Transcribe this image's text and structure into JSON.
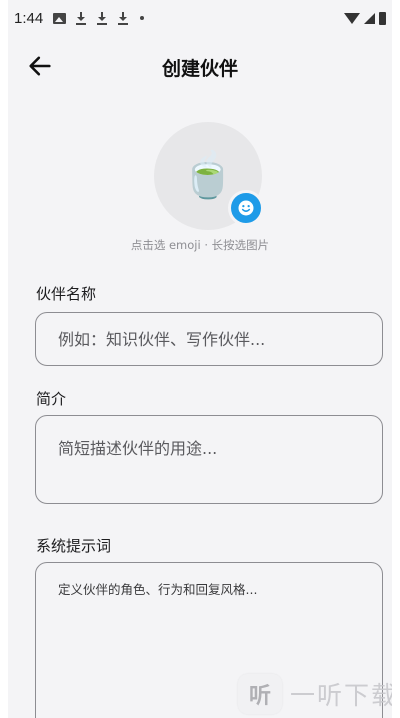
{
  "status_bar": {
    "time": "1:44",
    "left_icons": [
      "image-icon",
      "download-icon",
      "download-icon",
      "download-icon",
      "dot-icon"
    ],
    "right_icons": [
      "wifi-icon",
      "signal-icon",
      "battery-icon"
    ]
  },
  "app_bar": {
    "back_icon": "arrow-left-icon",
    "title": "创建伙伴"
  },
  "avatar": {
    "emoji": "🍵",
    "badge_icon": "emoji-smile-icon",
    "hint": "点击选 emoji · 长按选图片",
    "accent_color": "#1e9be8"
  },
  "form": {
    "name": {
      "label": "伙伴名称",
      "value": "",
      "placeholder": "例如：知识伙伴、写作伙伴..."
    },
    "description": {
      "label": "简介",
      "value": "",
      "placeholder": "简短描述伙伴的用途..."
    },
    "system_prompt": {
      "label": "系统提示词",
      "value": "",
      "placeholder": "定义伙伴的角色、行为和回复风格..."
    }
  },
  "watermark": {
    "logo_char": "听",
    "text": "一听下载"
  }
}
